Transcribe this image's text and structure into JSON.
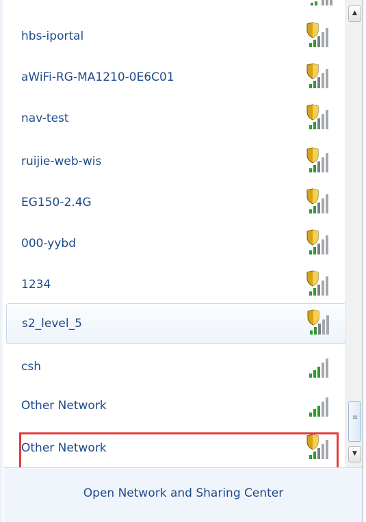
{
  "networks": [
    {
      "name": "hbs-iportal",
      "secured": true
    },
    {
      "name": "aWiFi-RG-MA1210-0E6C01",
      "secured": true
    },
    {
      "name": "nav-test",
      "secured": true
    },
    {
      "name": "ruijie-web-wis",
      "secured": true
    },
    {
      "name": "EG150-2.4G",
      "secured": true
    },
    {
      "name": "000-yybd",
      "secured": true
    },
    {
      "name": "1234",
      "secured": true
    },
    {
      "name": "s2_level_5",
      "secured": true,
      "selected": true
    },
    {
      "name": "csh",
      "secured": false
    },
    {
      "name": "Other Network",
      "secured": false
    },
    {
      "name": "Other Network",
      "secured": true,
      "highlighted": true
    }
  ],
  "footer": {
    "link_label": "Open Network and Sharing Center"
  },
  "icons": {
    "signal": "wifi-signal-icon",
    "security": "security-shield-icon"
  },
  "colors": {
    "link_text": "#1f4a8a",
    "highlight_border": "#e03a3a",
    "signal_bar_active": "#2e9b2e"
  },
  "scrollbar": {
    "up_glyph": "▲",
    "down_glyph": "▼",
    "grip_glyph": "≡"
  }
}
